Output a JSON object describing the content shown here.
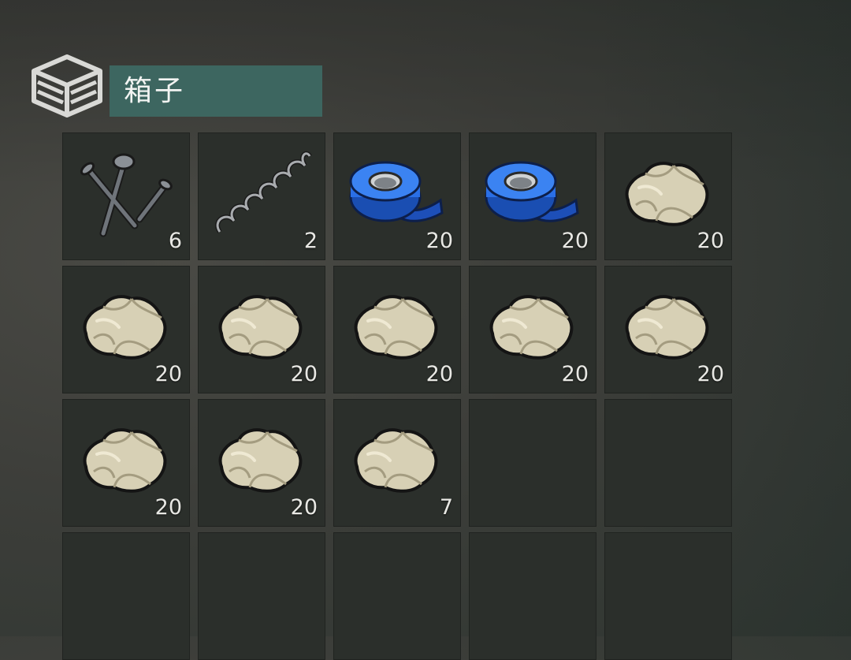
{
  "container": {
    "title": "箱子",
    "icon": "crate-icon"
  },
  "slots": [
    {
      "item": "nails",
      "icon": "nails-icon",
      "count": "6"
    },
    {
      "item": "spring",
      "icon": "spring-icon",
      "count": "2"
    },
    {
      "item": "duct-tape",
      "icon": "tape-icon",
      "count": "20"
    },
    {
      "item": "duct-tape",
      "icon": "tape-icon",
      "count": "20"
    },
    {
      "item": "stone",
      "icon": "stone-icon",
      "count": "20"
    },
    {
      "item": "stone",
      "icon": "stone-icon",
      "count": "20"
    },
    {
      "item": "stone",
      "icon": "stone-icon",
      "count": "20"
    },
    {
      "item": "stone",
      "icon": "stone-icon",
      "count": "20"
    },
    {
      "item": "stone",
      "icon": "stone-icon",
      "count": "20"
    },
    {
      "item": "stone",
      "icon": "stone-icon",
      "count": "20"
    },
    {
      "item": "stone",
      "icon": "stone-icon",
      "count": "20"
    },
    {
      "item": "stone",
      "icon": "stone-icon",
      "count": "20"
    },
    {
      "item": "stone",
      "icon": "stone-icon",
      "count": "7"
    },
    {
      "item": null,
      "icon": null,
      "count": null
    },
    {
      "item": null,
      "icon": null,
      "count": null
    },
    {
      "item": null,
      "icon": null,
      "count": null
    },
    {
      "item": null,
      "icon": null,
      "count": null
    },
    {
      "item": null,
      "icon": null,
      "count": null
    },
    {
      "item": null,
      "icon": null,
      "count": null
    },
    {
      "item": null,
      "icon": null,
      "count": null
    }
  ],
  "colors": {
    "title_bg": "#3d6660",
    "slot_bg": "#2b2f2b",
    "tape_blue": "#1f5fd6",
    "stone": "#d8d2b8"
  }
}
